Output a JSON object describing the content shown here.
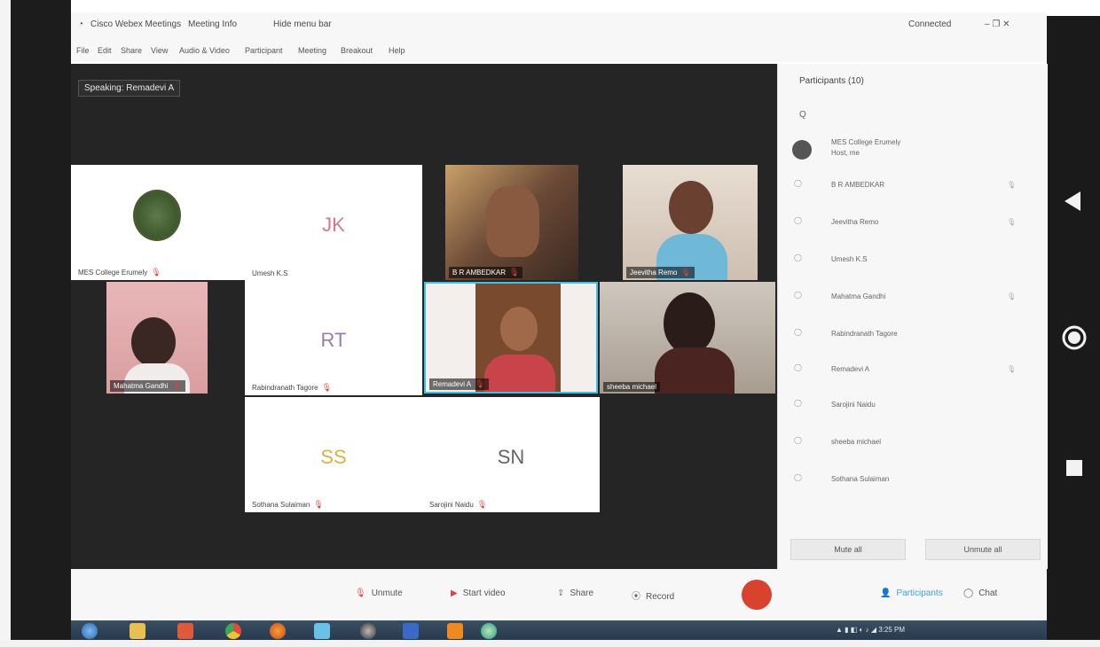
{
  "window": {
    "app_title": "Cisco Webex Meetings",
    "meeting_info": "Meeting Info",
    "hide_menu": "Hide menu bar",
    "connected": "Connected",
    "controls": "–  ❐  ✕"
  },
  "menu": [
    "File",
    "Edit",
    "Share",
    "View",
    "Audio & Video",
    "Participant",
    "Meeting",
    "Breakout",
    "Help"
  ],
  "speaking_label": "Speaking: Remadevi A",
  "tiles": [
    {
      "name": "MES College Erumely",
      "initials": "",
      "type": "avatar"
    },
    {
      "name": "Umesh K.S",
      "initials": "JK",
      "type": "initials",
      "color": "#d9778a"
    },
    {
      "name": "B R AMBEDKAR",
      "initials": "",
      "type": "video"
    },
    {
      "name": "Jeevitha Remo",
      "initials": "",
      "type": "video"
    },
    {
      "name": "Mahatma Gandhi",
      "initials": "",
      "type": "video"
    },
    {
      "name": "Rabindranath Tagore",
      "initials": "RT",
      "type": "initials",
      "color": "#9a7bb0"
    },
    {
      "name": "Remadevi A",
      "initials": "",
      "type": "video"
    },
    {
      "name": "sheeba michael",
      "initials": "",
      "type": "video"
    },
    {
      "name": "Sothana Sulaiman",
      "initials": "SS",
      "type": "initials",
      "color": "#e0b040"
    },
    {
      "name": "Sarojini Naidu",
      "initials": "SN",
      "type": "initials",
      "color": "#666666"
    }
  ],
  "panel": {
    "title": "Participants (10)",
    "search_placeholder": "Q",
    "participants": [
      {
        "name": "MES College Erumely",
        "sub": "Host, me"
      },
      {
        "name": "B R AMBEDKAR",
        "sub": ""
      },
      {
        "name": "Jeevitha Remo",
        "sub": ""
      },
      {
        "name": "Umesh K.S",
        "sub": ""
      },
      {
        "name": "Mahatma Gandhi",
        "sub": ""
      },
      {
        "name": "Rabindranath Tagore",
        "sub": ""
      },
      {
        "name": "Remadevi A",
        "sub": ""
      },
      {
        "name": "Sarojini Naidu",
        "sub": ""
      },
      {
        "name": "sheeba michael",
        "sub": ""
      },
      {
        "name": "Sothana Sulaiman",
        "sub": ""
      }
    ],
    "mute_all": "Mute all",
    "unmute_all": "Unmute all"
  },
  "toolbar": {
    "unmute": "Unmute",
    "start_video": "Start video",
    "share": "Share",
    "record": "Record",
    "participants": "Participants",
    "chat": "Chat"
  },
  "taskbar": {
    "clock": "3:25 PM"
  },
  "colors": {
    "record": "#d9422f",
    "meeting_bg": "#252525",
    "active_border": "#3fc0e8"
  }
}
